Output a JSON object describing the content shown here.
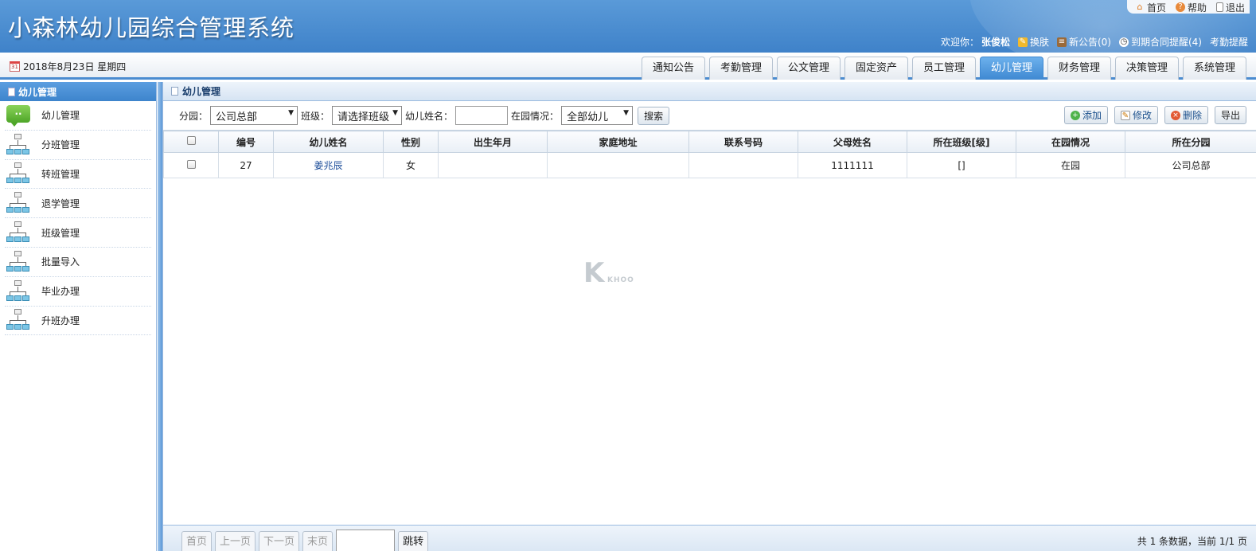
{
  "app": {
    "title": "小森林幼儿园综合管理系统"
  },
  "top_links": [
    {
      "label": "首页",
      "icon": "home-icon"
    },
    {
      "label": "帮助",
      "icon": "help-icon"
    },
    {
      "label": "退出",
      "icon": "exit-icon"
    }
  ],
  "user_bar": {
    "welcome": "欢迎你：",
    "username": "张俊松",
    "skin": "换肤",
    "notice": "新公告(0)",
    "contract": "到期合同提醒(4)",
    "attendance": "考勤提醒"
  },
  "nav": {
    "date": "2018年8月23日 星期四",
    "tabs": [
      "通知公告",
      "考勤管理",
      "公文管理",
      "固定资产",
      "员工管理",
      "幼儿管理",
      "财务管理",
      "决策管理",
      "系统管理"
    ],
    "active_tab": "幼儿管理"
  },
  "sidebar": {
    "title": "幼儿管理",
    "items": [
      {
        "label": "幼儿管理",
        "icon": "chat-icon"
      },
      {
        "label": "分班管理",
        "icon": "org-tree-icon"
      },
      {
        "label": "转班管理",
        "icon": "org-tree-icon"
      },
      {
        "label": "退学管理",
        "icon": "org-tree-icon"
      },
      {
        "label": "班级管理",
        "icon": "org-tree-icon"
      },
      {
        "label": "批量导入",
        "icon": "org-tree-icon"
      },
      {
        "label": "毕业办理",
        "icon": "org-tree-icon"
      },
      {
        "label": "升班办理",
        "icon": "org-tree-icon"
      }
    ]
  },
  "main": {
    "title": "幼儿管理",
    "filter": {
      "branch_label": "分园：",
      "branch_value": "公司总部",
      "class_label": "班级：",
      "class_value": "请选择班级",
      "name_label": "幼儿姓名：",
      "name_value": "",
      "status_label": "在园情况：",
      "status_value": "全部幼儿",
      "search": "搜索"
    },
    "actions": {
      "add": "添加",
      "edit": "修改",
      "delete": "删除",
      "export": "导出"
    },
    "table": {
      "headers": [
        "",
        "编号",
        "幼儿姓名",
        "性别",
        "出生年月",
        "家庭地址",
        "联系号码",
        "父母姓名",
        "所在班级[级]",
        "在园情况",
        "所在分园"
      ],
      "rows": [
        [
          "",
          "27",
          "姜兆辰",
          "女",
          "",
          "",
          "",
          "1111111",
          "[]",
          "在园",
          "公司总部"
        ]
      ]
    },
    "pager": {
      "first": "首页",
      "prev": "上一页",
      "next": "下一页",
      "last": "末页",
      "jump": "跳转",
      "jump_value": "",
      "info": "共 1 条数据，当前 1/1 页"
    }
  },
  "watermark": {
    "main": "K",
    "sub": "KHOO"
  },
  "colors": {
    "header_blue": "#3f82c9",
    "active_tab": "#4a8bd0",
    "link": "#1f4f9a"
  }
}
